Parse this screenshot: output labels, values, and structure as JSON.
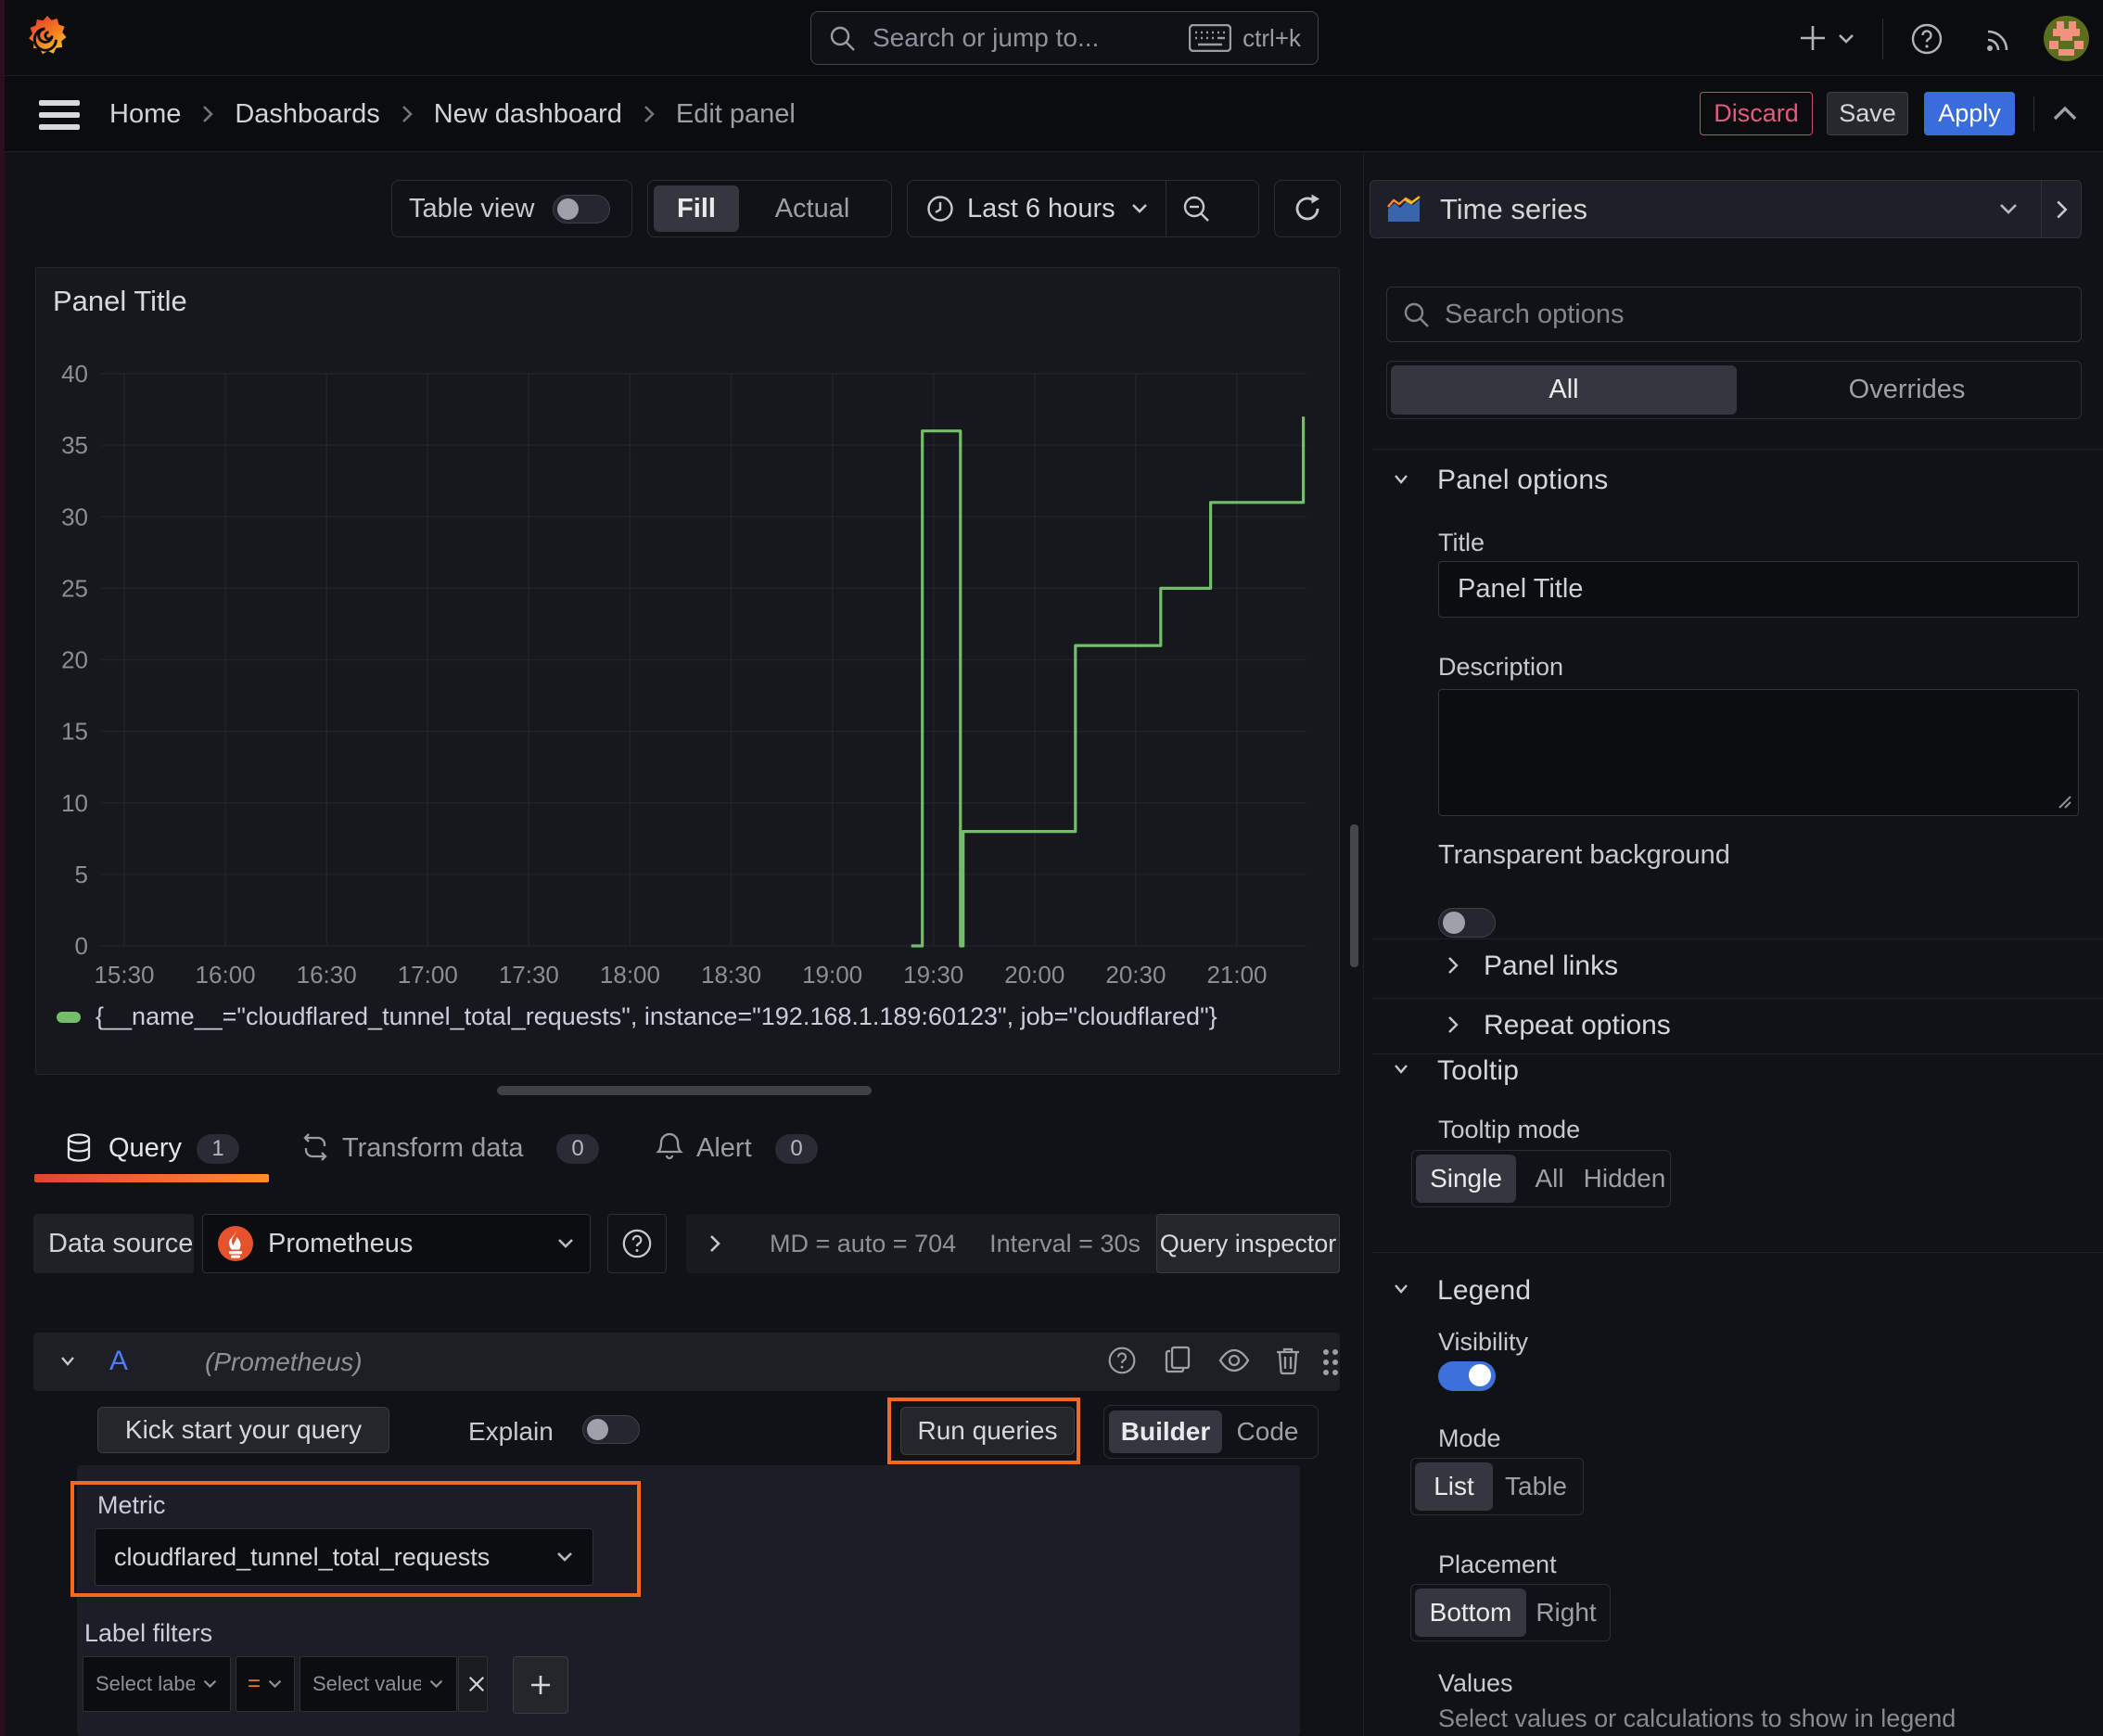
{
  "topbar": {
    "search_placeholder": "Search or jump to...",
    "shortcut": "ctrl+k"
  },
  "breadcrumb": {
    "items": [
      "Home",
      "Dashboards",
      "New dashboard",
      "Edit panel"
    ]
  },
  "actions": {
    "discard": "Discard",
    "save": "Save",
    "apply": "Apply"
  },
  "panel_toolbar": {
    "table_view": "Table view",
    "fill": "Fill",
    "actual": "Actual",
    "time_range": "Last 6 hours"
  },
  "panel": {
    "title": "Panel Title"
  },
  "chart_data": {
    "type": "line",
    "line_style": "step-after",
    "series_color": "#73bf69",
    "title": "",
    "xlabel": "",
    "ylabel": "",
    "ylim": [
      0,
      40
    ],
    "y_ticks": [
      0,
      5,
      10,
      15,
      20,
      25,
      30,
      35,
      40
    ],
    "x_ticks": [
      "15:30",
      "16:00",
      "16:30",
      "17:00",
      "17:30",
      "18:00",
      "18:30",
      "19:00",
      "19:30",
      "20:00",
      "20:30",
      "21:00"
    ],
    "x_tick_interval_minutes": 30,
    "x_domain_minutes": [
      -7,
      351
    ],
    "grid": true,
    "legend_position": "bottom",
    "series": [
      {
        "name": "{__name__=\"cloudflared_tunnel_total_requests\", instance=\"192.168.1.189:60123\", job=\"cloudflared\"}",
        "points_t_minutes_from_1530_and_value": [
          [
            233.4,
            0
          ],
          [
            236.7,
            0
          ],
          [
            236.7,
            36
          ],
          [
            248.0,
            36
          ],
          [
            248.0,
            0
          ],
          [
            248.8,
            0
          ],
          [
            248.8,
            8
          ],
          [
            282.1,
            8
          ],
          [
            282.1,
            21
          ],
          [
            307.4,
            21
          ],
          [
            307.4,
            25
          ],
          [
            322.2,
            25
          ],
          [
            322.2,
            31
          ],
          [
            349.7,
            31
          ],
          [
            349.7,
            37
          ]
        ]
      }
    ]
  },
  "query_tabs": {
    "query": "Query",
    "query_count": "1",
    "transform": "Transform data",
    "transform_count": "0",
    "alert": "Alert",
    "alert_count": "0"
  },
  "datasource_row": {
    "label": "Data source",
    "value": "Prometheus",
    "md_stat": "MD = auto = 704",
    "interval_stat": "Interval = 30s",
    "inspector": "Query inspector"
  },
  "query_row": {
    "ref": "A",
    "ds_hint": "(Prometheus)",
    "kickstart": "Kick start your query",
    "explain": "Explain",
    "run": "Run queries",
    "builder": "Builder",
    "code": "Code",
    "metric_label": "Metric",
    "metric_value": "cloudflared_tunnel_total_requests",
    "label_filters_label": "Label filters",
    "select_label": "Select label",
    "operator": "=",
    "select_value": "Select value",
    "remove": "x"
  },
  "viz_picker": {
    "name": "Time series"
  },
  "options": {
    "search_placeholder": "Search options",
    "tab_all": "All",
    "tab_overrides": "Overrides",
    "panel_options": "Panel options",
    "title_label": "Title",
    "title_value": "Panel Title",
    "description_label": "Description",
    "transparent_label": "Transparent background",
    "panel_links": "Panel links",
    "repeat_options": "Repeat options",
    "tooltip": "Tooltip",
    "tooltip_mode": "Tooltip mode",
    "tooltip_single": "Single",
    "tooltip_all": "All",
    "tooltip_hidden": "Hidden",
    "legend": "Legend",
    "visibility": "Visibility",
    "mode": "Mode",
    "mode_list": "List",
    "mode_table": "Table",
    "placement": "Placement",
    "placement_bottom": "Bottom",
    "placement_right": "Right",
    "values": "Values",
    "values_desc": "Select values or calculations to show in legend"
  },
  "colors": {
    "accent_orange": "#f2691f",
    "green_series": "#73bf69",
    "blue_primary": "#3d71d9",
    "red_discard": "#e0537b",
    "operator_orange": "#eb7b18"
  }
}
